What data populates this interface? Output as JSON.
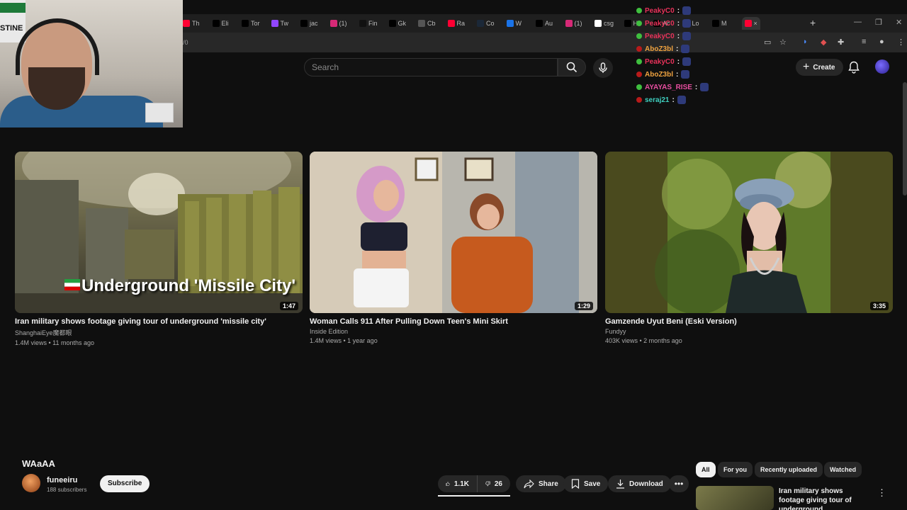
{
  "browser": {
    "tabs": [
      {
        "icon": "youtube-icon",
        "label": "Th",
        "color": "#ff0033"
      },
      {
        "icon": "x-icon",
        "label": "Eli",
        "color": "#000000"
      },
      {
        "icon": "x-icon",
        "label": "Tor",
        "color": "#000000"
      },
      {
        "icon": "twitch-icon",
        "label": "Tw",
        "color": "#9146ff"
      },
      {
        "icon": "x-icon",
        "label": "jac",
        "color": "#000000"
      },
      {
        "icon": "instagram-icon",
        "label": "(1)",
        "color": "#d62976"
      },
      {
        "icon": "tiktok-icon",
        "label": "Fin",
        "color": "#111111"
      },
      {
        "icon": "x-icon",
        "label": "Gk",
        "color": "#000000"
      },
      {
        "icon": "globe-icon",
        "label": "Cb",
        "color": "#555555"
      },
      {
        "icon": "youtube-icon",
        "label": "Ra",
        "color": "#ff0033"
      },
      {
        "icon": "steam-icon",
        "label": "Co",
        "color": "#1b2838"
      },
      {
        "icon": "link-icon",
        "label": "W",
        "color": "#1a73e8"
      },
      {
        "icon": "x-icon",
        "label": "Au",
        "color": "#000000"
      },
      {
        "icon": "instagram-icon",
        "label": "(1)",
        "color": "#d62976"
      },
      {
        "icon": "google-icon",
        "label": "csg",
        "color": "#ffffff"
      },
      {
        "icon": "x-icon",
        "label": "Hc",
        "color": "#000000"
      },
      {
        "icon": "x-icon",
        "label": "Ac",
        "color": "#000000"
      },
      {
        "icon": "youtube-icon",
        "label": "Lo",
        "color": "#ff0033"
      },
      {
        "icon": "x-icon",
        "label": "M",
        "color": "#000000"
      },
      {
        "icon": "youtube-icon",
        "label": "×",
        "color": "#ff0033"
      }
    ],
    "url_fragment": "/0"
  },
  "header": {
    "search_placeholder": "Search",
    "create_label": "Create"
  },
  "chat": [
    {
      "user": "PeakyC0",
      "color": "#e8325a",
      "badge": "#3fbf3f"
    },
    {
      "user": "PeakyC0",
      "color": "#e8325a",
      "badge": "#3fbf3f"
    },
    {
      "user": "PeakyC0",
      "color": "#e8325a",
      "badge": "#3fbf3f"
    },
    {
      "user": "AboZ3bl",
      "color": "#f0a340",
      "badge": "#b81a1a"
    },
    {
      "user": "PeakyC0",
      "color": "#e8325a",
      "badge": "#3fbf3f"
    },
    {
      "user": "AboZ3bl",
      "color": "#f0a340",
      "badge": "#b81a1a"
    },
    {
      "user": "AYAYAS_RISE",
      "color": "#e84ea0",
      "badge": "#3fbf3f"
    },
    {
      "user": "seraj21",
      "color": "#3fd0c0",
      "badge": "#b81a1a"
    }
  ],
  "webcam": {
    "sign_text": "STINE"
  },
  "videos": [
    {
      "title": "Iran military shows footage giving tour of underground 'missile city'",
      "channel": "ShanghaiEye魔都眼",
      "meta": "1.4M views • 11 months ago",
      "duration": "1:47",
      "thumb_text": "Underground 'Missile City'"
    },
    {
      "title": "Woman Calls 911 After Pulling Down Teen's Mini Skirt",
      "channel": "Inside Edition",
      "meta": "1.4M views • 1 year ago",
      "duration": "1:29"
    },
    {
      "title": "Gamzende Uyut Beni (Eski Version)",
      "channel": "Fundyy",
      "meta": "403K views • 2 months ago",
      "duration": "3:35"
    }
  ],
  "watch": {
    "title": "WAaAA",
    "channel_name": "funeeiru",
    "subscribers": "188 subscribers",
    "subscribe_label": "Subscribe",
    "likes": "1.1K",
    "dislikes": "26",
    "share_label": "Share",
    "save_label": "Save",
    "download_label": "Download"
  },
  "sidebar": {
    "chips": [
      "All",
      "For you",
      "Recently uploaded",
      "Watched"
    ],
    "rec_title": "Iran military shows footage giving tour of underground"
  }
}
